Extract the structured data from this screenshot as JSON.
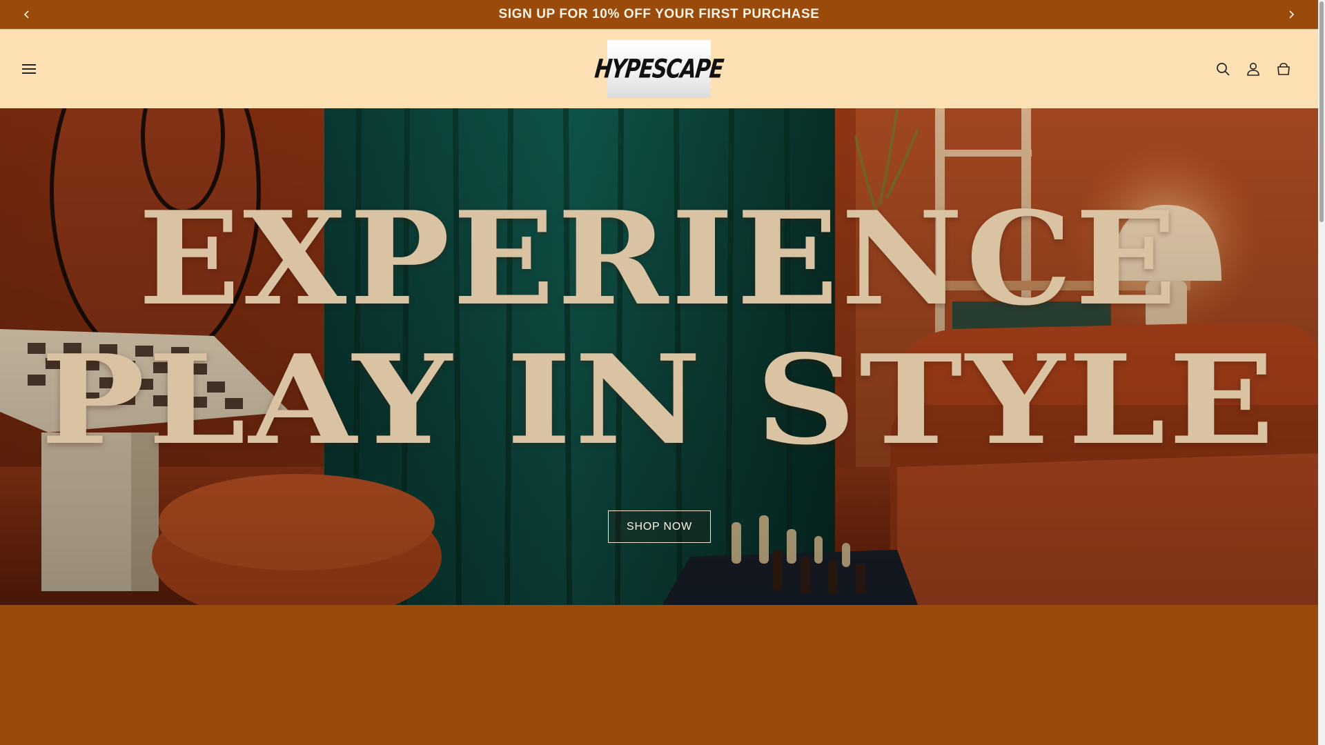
{
  "announcement": {
    "message": "SIGN UP FOR 10% OFF YOUR FIRST PURCHASE",
    "prev_icon": "chevron-left-icon",
    "next_icon": "chevron-right-icon"
  },
  "header": {
    "menu_icon": "hamburger-menu-icon",
    "logo_text": "HYPESCAPE",
    "icons": [
      "search-icon",
      "account-icon",
      "cart-icon"
    ]
  },
  "hero": {
    "headline_line1": "EXPERIENCE",
    "headline_line2": "PLAY IN STYLE",
    "cta_label": "SHOP NOW"
  },
  "colors": {
    "announcement_bg": "#9a4a0a",
    "header_bg": "#fee0b5",
    "headline_text": "#d9c3a2",
    "page_bg": "#9a4a0a"
  }
}
